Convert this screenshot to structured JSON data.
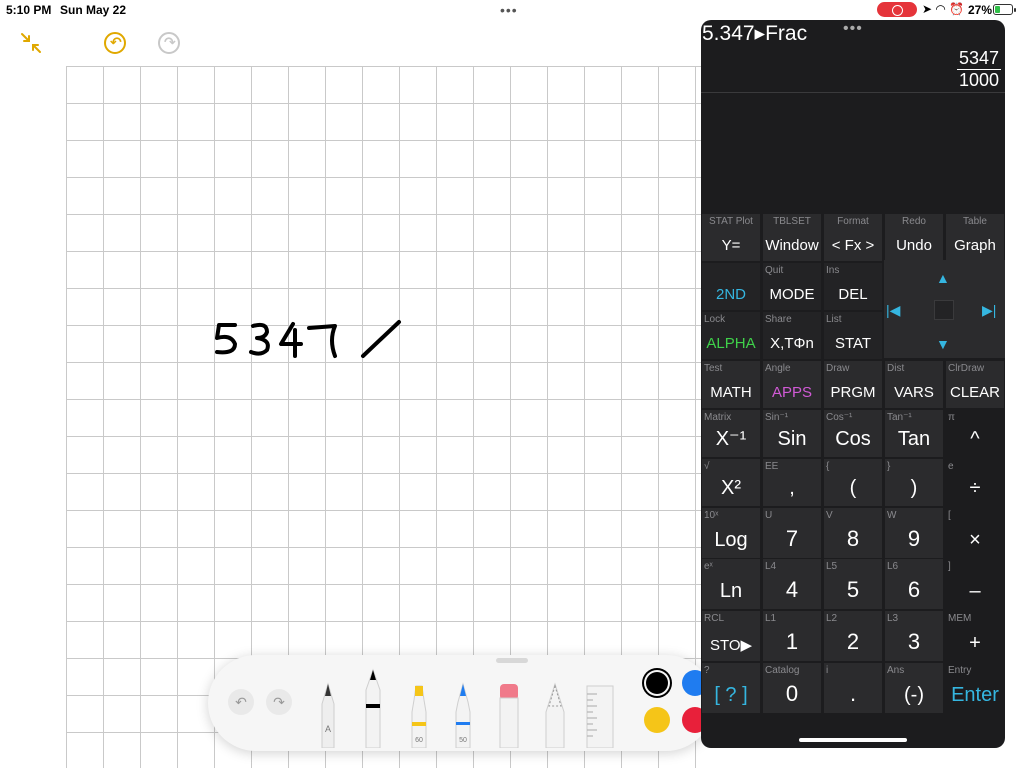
{
  "status_bar": {
    "time": "5:10 PM",
    "date": "Sun May 22",
    "battery": "27%"
  },
  "calculator": {
    "expression": "5.347▸Frac",
    "result_numerator": "5347",
    "result_denominator": "1000",
    "keys": [
      {
        "sec": "STAT Plot",
        "main": "Y=",
        "col": 0,
        "row": 0
      },
      {
        "sec": "TBLSET",
        "main": "Window",
        "col": 1,
        "row": 0
      },
      {
        "sec": "Format",
        "main": "< Fx >",
        "col": 2,
        "row": 0
      },
      {
        "sec": "Redo",
        "main": "Undo",
        "col": 3,
        "row": 0
      },
      {
        "sec": "Table",
        "main": "Graph",
        "col": 4,
        "row": 0
      },
      {
        "sec": "",
        "main": "2ND",
        "col": 0,
        "row": 1,
        "color": "#35b6e0"
      },
      {
        "sec": "Quit",
        "main": "MODE",
        "col": 1,
        "row": 1
      },
      {
        "sec": "Ins",
        "main": "DEL",
        "col": 2,
        "row": 1
      },
      {
        "sec": "Lock",
        "main": "ALPHA",
        "col": 0,
        "row": 2,
        "color": "#3fd14a"
      },
      {
        "sec": "Share",
        "main": "X,TΦn",
        "col": 1,
        "row": 2
      },
      {
        "sec": "List",
        "main": "STAT",
        "col": 2,
        "row": 2
      },
      {
        "sec": "Test",
        "main": "MATH",
        "col": 0,
        "row": 3
      },
      {
        "sec": "Angle",
        "main": "APPS",
        "col": 1,
        "row": 3,
        "color": "#d15ad6"
      },
      {
        "sec": "Draw",
        "main": "PRGM",
        "col": 2,
        "row": 3
      },
      {
        "sec": "Dist",
        "main": "VARS",
        "col": 3,
        "row": 3
      },
      {
        "sec": "ClrDraw",
        "main": "CLEAR",
        "col": 4,
        "row": 3
      },
      {
        "sec": "Matrix",
        "main": "X⁻¹",
        "col": 0,
        "row": 4,
        "big": true
      },
      {
        "sec": "Sin⁻¹",
        "main": "Sin",
        "col": 1,
        "row": 4,
        "big": true
      },
      {
        "sec": "Cos⁻¹",
        "main": "Cos",
        "col": 2,
        "row": 4,
        "big": true
      },
      {
        "sec": "Tan⁻¹",
        "main": "Tan",
        "col": 3,
        "row": 4,
        "big": true
      },
      {
        "sec": "π",
        "main": "^",
        "col": 4,
        "row": 4,
        "big": true,
        "right": true
      },
      {
        "sec": "√",
        "main": "X²",
        "col": 0,
        "row": 5,
        "big": true
      },
      {
        "sec": "EE",
        "main": ",",
        "col": 1,
        "row": 5,
        "big": true
      },
      {
        "sec": "{",
        "main": "(",
        "col": 2,
        "row": 5,
        "big": true
      },
      {
        "sec": "}",
        "main": ")",
        "col": 3,
        "row": 5,
        "big": true
      },
      {
        "sec": "e",
        "main": "÷",
        "col": 4,
        "row": 5,
        "big": true,
        "right": true
      },
      {
        "sec": "10ˣ",
        "main": "Log",
        "col": 0,
        "row": 6,
        "big": true
      },
      {
        "sec": "U",
        "main": "7",
        "col": 1,
        "row": 6,
        "num": true
      },
      {
        "sec": "V",
        "main": "8",
        "col": 2,
        "row": 6,
        "num": true
      },
      {
        "sec": "W",
        "main": "9",
        "col": 3,
        "row": 6,
        "num": true
      },
      {
        "sec": "[",
        "main": "×",
        "col": 4,
        "row": 6,
        "big": true,
        "right": true
      },
      {
        "sec": "eˣ",
        "main": "Ln",
        "col": 0,
        "row": 7,
        "big": true
      },
      {
        "sec": "L4",
        "main": "4",
        "col": 1,
        "row": 7,
        "num": true
      },
      {
        "sec": "L5",
        "main": "5",
        "col": 2,
        "row": 7,
        "num": true
      },
      {
        "sec": "L6",
        "main": "6",
        "col": 3,
        "row": 7,
        "num": true
      },
      {
        "sec": "]",
        "main": "–",
        "col": 4,
        "row": 7,
        "big": true,
        "right": true
      },
      {
        "sec": "RCL",
        "main": "STO▶",
        "col": 0,
        "row": 8
      },
      {
        "sec": "L1",
        "main": "1",
        "col": 1,
        "row": 8,
        "num": true
      },
      {
        "sec": "L2",
        "main": "2",
        "col": 2,
        "row": 8,
        "num": true
      },
      {
        "sec": "L3",
        "main": "3",
        "col": 3,
        "row": 8,
        "num": true
      },
      {
        "sec": "MEM",
        "main": "+",
        "col": 4,
        "row": 8,
        "big": true,
        "right": true
      },
      {
        "sec": "?",
        "main": "[ ? ]",
        "col": 0,
        "row": 9,
        "big": true,
        "color": "#35b6e0"
      },
      {
        "sec": "Catalog",
        "main": "0",
        "col": 1,
        "row": 9,
        "num": true
      },
      {
        "sec": "i",
        "main": ".",
        "col": 2,
        "row": 9,
        "num": true
      },
      {
        "sec": "Ans",
        "main": "(-)",
        "col": 3,
        "row": 9,
        "big": true
      },
      {
        "sec": "Entry",
        "main": "Enter",
        "col": 4,
        "row": 9,
        "big": true,
        "right": true,
        "color": "#35b6e0"
      }
    ]
  },
  "handwriting": {
    "text": "5347 /"
  },
  "palette": {
    "selected_color": "#000000",
    "colors": [
      "#000000",
      "#1f7cf0",
      "#f5c518",
      "#e8203a"
    ],
    "pencil_label_a": "A",
    "marker_label_1": "60",
    "marker_label_2": "50"
  }
}
